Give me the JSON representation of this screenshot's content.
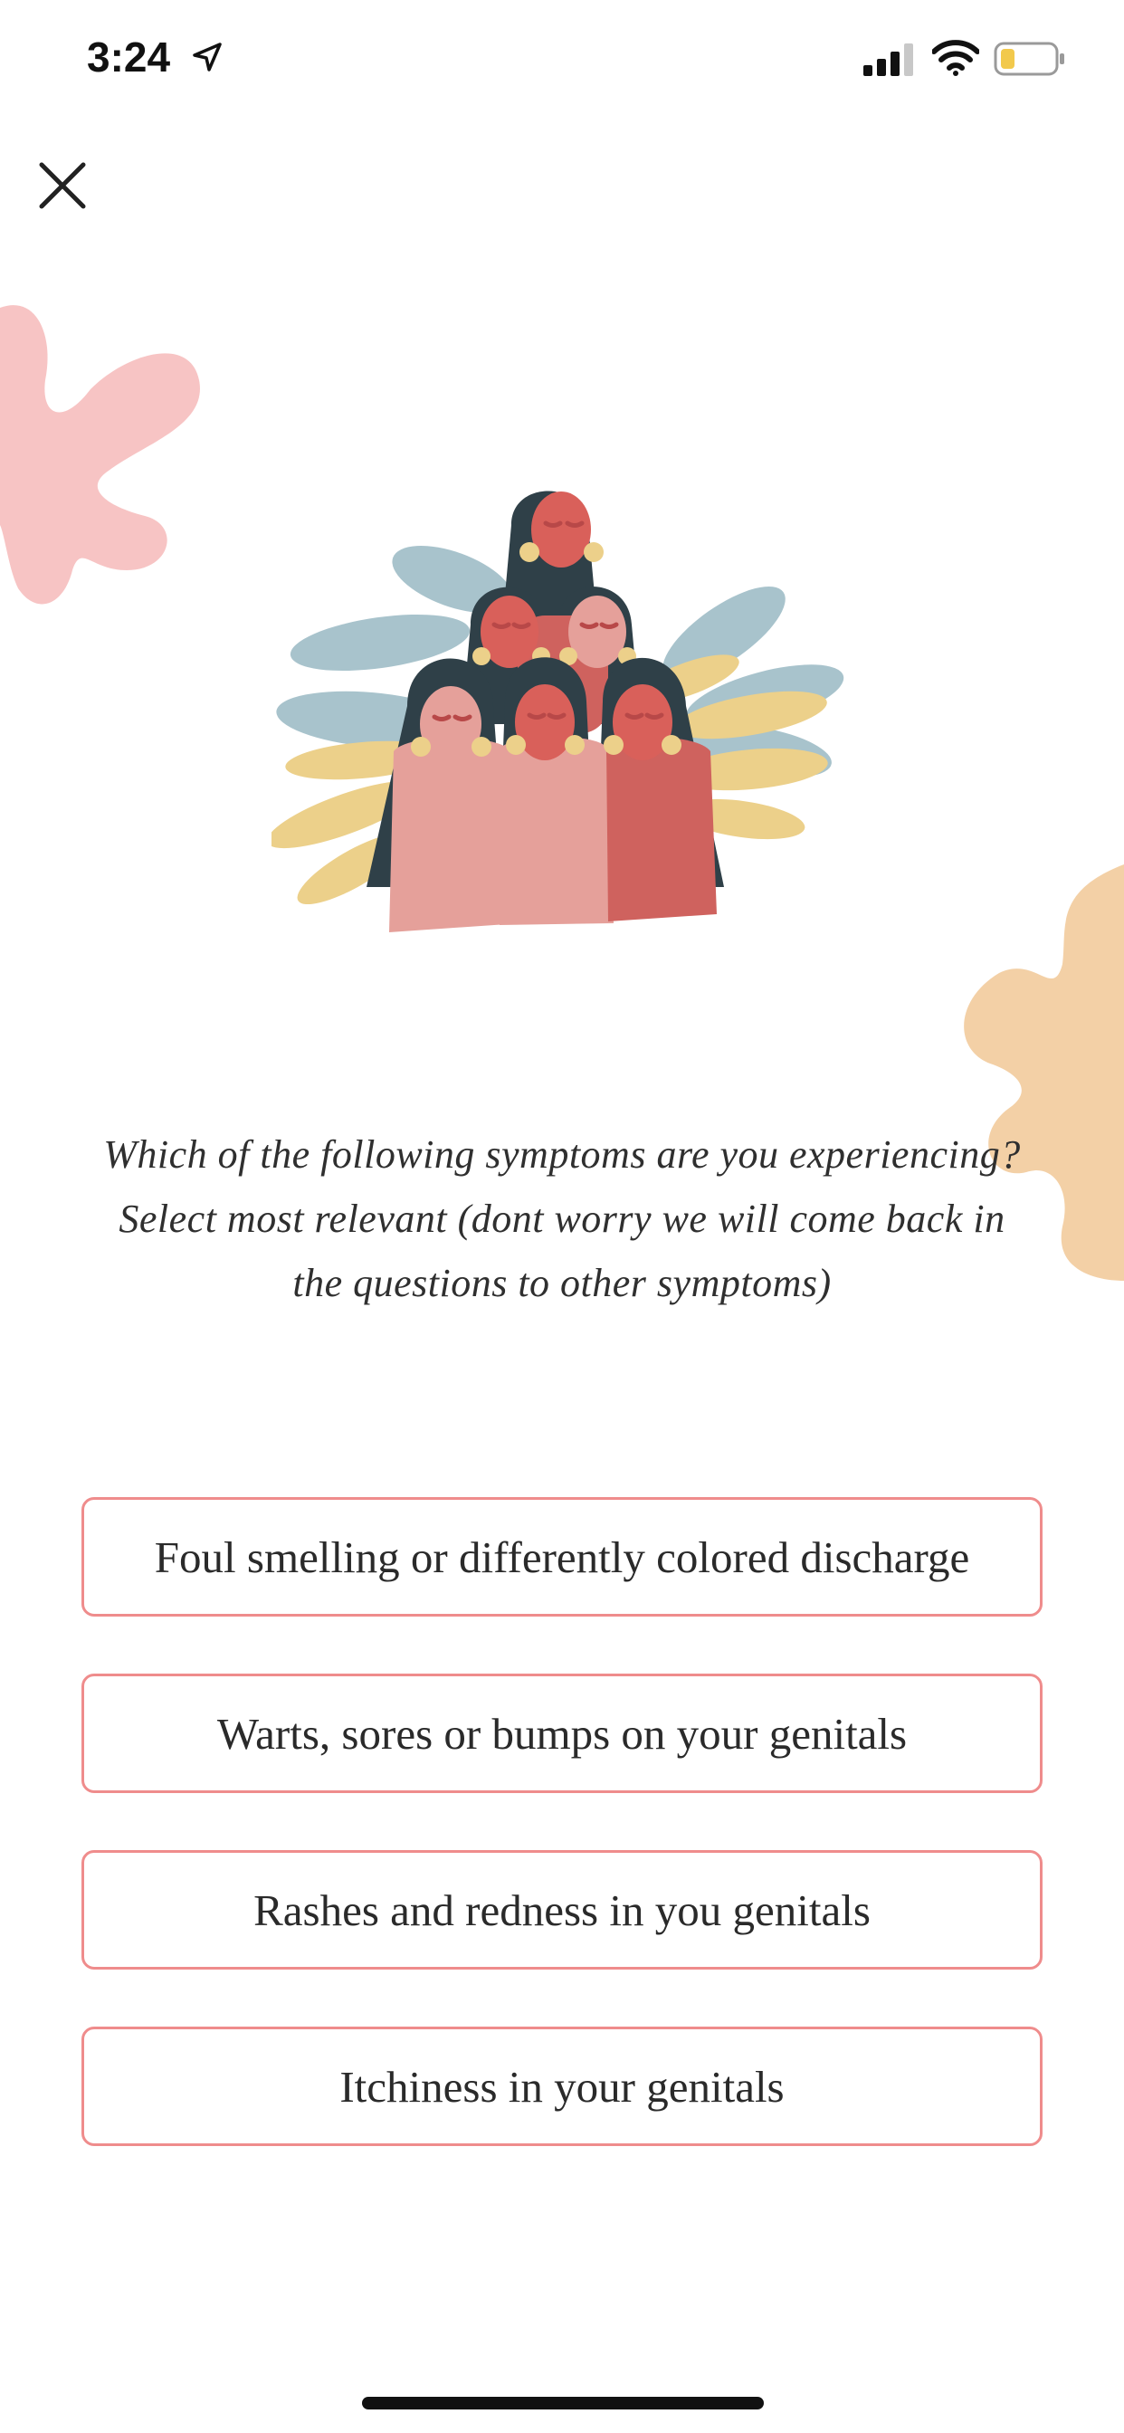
{
  "status_bar": {
    "time": "3:24",
    "icons": [
      "location-arrow-icon",
      "signal-icon",
      "wifi-icon",
      "battery-icon"
    ],
    "battery_color": "#f2c94c"
  },
  "close_button": {
    "icon": "close-icon"
  },
  "illustration": {
    "icon": "women-group-illustration"
  },
  "question": "Which of the following symptoms are you experiencing? Select most relevant (dont worry we will come back in the questions to other symptoms)",
  "options": [
    {
      "label": "Foul smelling or differently colored discharge"
    },
    {
      "label": "Warts, sores or bumps on your genitals"
    },
    {
      "label": "Rashes and redness in you genitals"
    },
    {
      "label": "Itchiness in your genitals"
    }
  ],
  "colors": {
    "option_border": "#ef8c8c",
    "blob_pink": "#f7c4c4",
    "blob_orange": "#f3d0a6",
    "leaf_blue": "#a8c3cc",
    "leaf_yellow": "#ecd08a",
    "hair": "#2f4048",
    "skin": "#d9605a",
    "dress_pink": "#e5a09a",
    "dress_red": "#cf625e"
  }
}
